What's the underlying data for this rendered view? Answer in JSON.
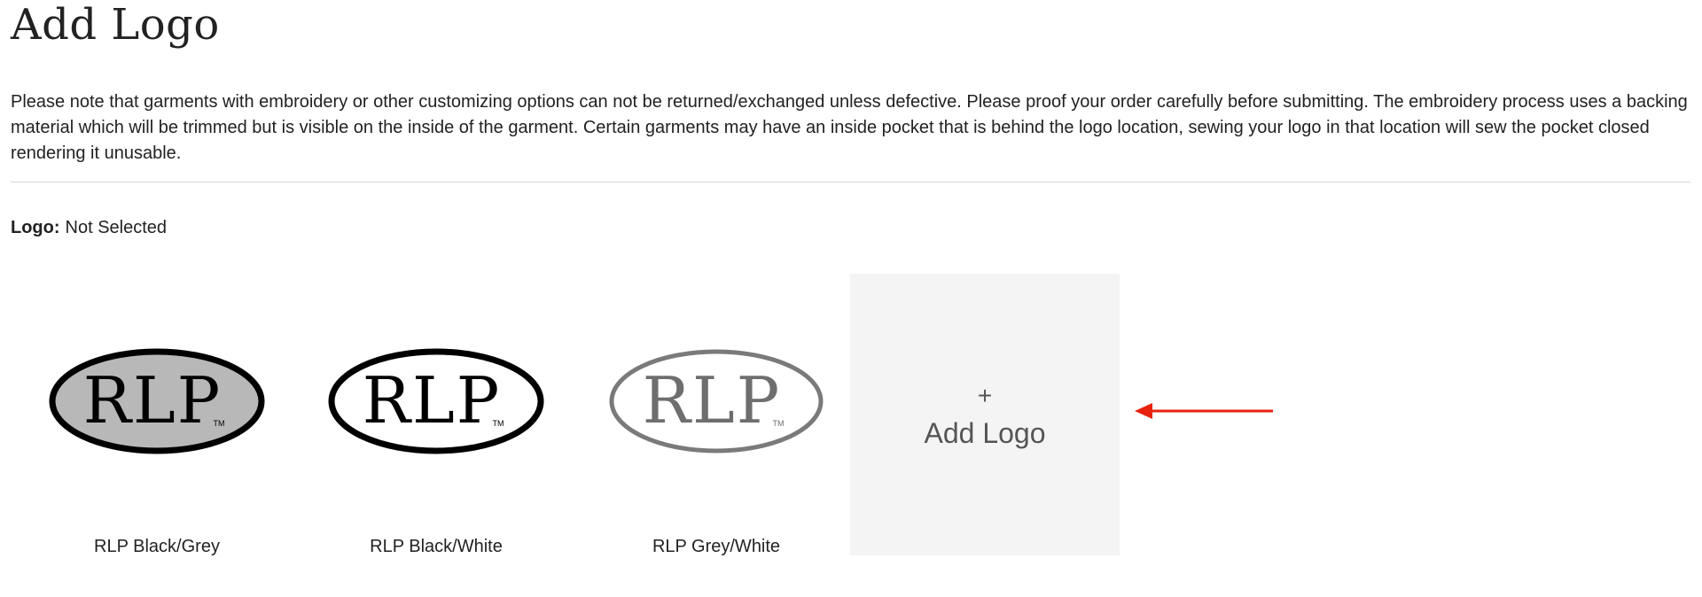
{
  "page": {
    "title": "Add Logo",
    "notice": "Please note that garments with embroidery or other customizing options can not be returned/exchanged unless defective. Please proof your order carefully before submitting. The embroidery process uses a backing material which will be trimmed but is visible on the inside of the garment. Certain garments may have an inside pocket that is behind the logo location, sewing your logo in that location will sew the pocket closed rendering it unusable."
  },
  "logo_status": {
    "label": "Logo:",
    "value": "Not Selected"
  },
  "logo_options": [
    {
      "name": "RLP Black/Grey",
      "logo_text": "RLP",
      "tm": "TM",
      "fill": "#b8b8b8",
      "ring": "#000000",
      "text_color": "#000000"
    },
    {
      "name": "RLP Black/White",
      "logo_text": "RLP",
      "tm": "TM",
      "fill": "#ffffff",
      "ring": "#000000",
      "text_color": "#000000"
    },
    {
      "name": "RLP Grey/White",
      "logo_text": "RLP",
      "tm": "TM",
      "fill": "#ffffff",
      "ring": "#7a7a7a",
      "text_color": "#6e6e6e"
    }
  ],
  "add_logo_tile": {
    "icon": "plus-icon",
    "plus": "+",
    "label": "Add Logo"
  },
  "annotation": {
    "icon": "red-arrow-icon",
    "color": "#e8220f"
  }
}
